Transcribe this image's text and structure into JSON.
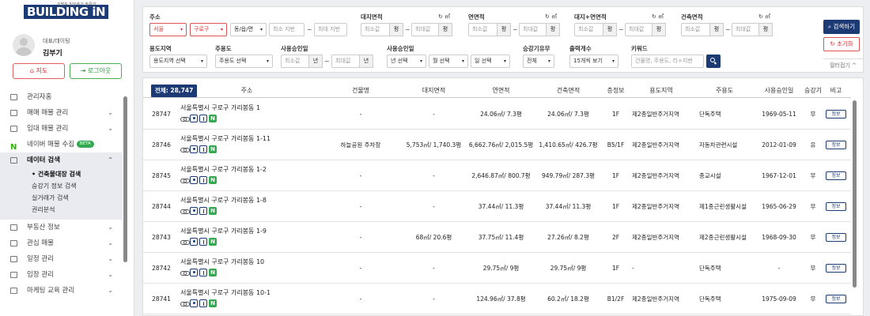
{
  "logo": {
    "text": "BUILDING iN",
    "tagline": "성명된 빌딩주거 솔루션"
  },
  "profile": {
    "role": "대표/데이팅",
    "name": "김부기"
  },
  "profile_buttons": {
    "map": "지도",
    "logout": "로그아웃"
  },
  "menu": [
    {
      "label": "관리자홈",
      "chev": ""
    },
    {
      "label": "매매 매물 관리",
      "chev": "⌄"
    },
    {
      "label": "임대 매물 관리",
      "chev": "⌄"
    },
    {
      "label": "네이버 매물 수집",
      "chev": "",
      "badge": "BETA"
    },
    {
      "label": "데이터 검색",
      "chev": "⌃"
    }
  ],
  "submenu": [
    "건축물대장 검색",
    "승강기 정보 검색",
    "실거래가 검색",
    "권리분석"
  ],
  "menu2": [
    {
      "label": "부동산 정보",
      "chev": "⌄"
    },
    {
      "label": "관심 매물",
      "chev": "⌄"
    },
    {
      "label": "일정 관리",
      "chev": "⌄"
    },
    {
      "label": "임장 관리",
      "chev": "⌄"
    },
    {
      "label": "마케팅 교육 관리",
      "chev": "⌄"
    }
  ],
  "filters": {
    "address_label": "주소",
    "sido": "서울",
    "gu": "구로구",
    "dong": "동/읍/면",
    "jibun_min": "최소 지번",
    "jibun_max": "최대 지번",
    "land_label": "대지면적",
    "floor_label": "연면적",
    "landfloor_label": "대지+연면적",
    "building_label": "건축면적",
    "min": "최소값",
    "max": "최대값",
    "unit_pyeong": "평",
    "unit_year": "년",
    "refresh": "↻ ㎡",
    "usezone_label": "용도지역",
    "usezone_value": "용도지역 선택",
    "mainuse_label": "주용도",
    "mainuse_value": "주용도 선택",
    "approval_label": "사용승인일",
    "approval_date_label": "사용승인일",
    "year_select": "년 선택",
    "month_select": "월 선택",
    "day_select": "일 선택",
    "elevator_label": "승강기유무",
    "elevator_value": "전체",
    "count_label": "출력개수",
    "count_value": "15개씩 보기",
    "keyword_label": "키워드",
    "keyword_placeholder": "건물명, 주용도, 리+지번",
    "search_button": "검색하기",
    "reset_button": "초기화",
    "fold_button": "필터접기 ^"
  },
  "table": {
    "total": "전체: 28,747",
    "headers": [
      "주소",
      "건물명",
      "대지면적",
      "연면적",
      "건축면적",
      "층정보",
      "용도지역",
      "주용도",
      "사용승인일",
      "승강기",
      "비고"
    ],
    "info_label": "정보",
    "rows": [
      {
        "no": "28747",
        "addr": "서울특별시 구로구 가리봉동 1",
        "name": "-",
        "land": "-",
        "floor": "24.06㎡/ 7.3평",
        "build": "24.06㎡/ 7.3평",
        "fl": "1F",
        "zone": "제2종일반주거지역",
        "use": "단독주택",
        "date": "1969-05-11",
        "elev": "무"
      },
      {
        "no": "28746",
        "addr": "서울특별시 구로구 가리봉동 1-11",
        "name": "하늘공원 주차장",
        "land": "5,753㎡/ 1,740.3평",
        "floor": "6,662.76㎡/ 2,015.5평",
        "build": "1,410.65㎡/ 426.7평",
        "fl": "B5/1F",
        "zone": "제2종일반주거지역",
        "use": "자동차관련시설",
        "date": "2012-01-09",
        "elev": "유"
      },
      {
        "no": "28745",
        "addr": "서울특별시 구로구 가리봉동 1-2",
        "name": "-",
        "land": "-",
        "floor": "2,646.87㎡/ 800.7평",
        "build": "949.79㎡/ 287.3평",
        "fl": "1F",
        "zone": "제2종일반주거지역",
        "use": "종교시설",
        "date": "1967-12-01",
        "elev": "무"
      },
      {
        "no": "28744",
        "addr": "서울특별시 구로구 가리봉동 1-8",
        "name": "-",
        "land": "-",
        "floor": "37.44㎡/ 11.3평",
        "build": "37.44㎡/ 11.3평",
        "fl": "1F",
        "zone": "제2종일반주거지역",
        "use": "제1종근린생활시설",
        "date": "1965-06-29",
        "elev": "무"
      },
      {
        "no": "28743",
        "addr": "서울특별시 구로구 가리봉동 1-9",
        "name": "-",
        "land": "68㎡/ 20.6평",
        "floor": "37.75㎡/ 11.4평",
        "build": "27.26㎡/ 8.2평",
        "fl": "2F",
        "zone": "제2종일반주거지역",
        "use": "제2종근린생활시설",
        "date": "1968-09-30",
        "elev": "무"
      },
      {
        "no": "28742",
        "addr": "서울특별시 구로구 가리봉동 10",
        "name": "-",
        "land": "-",
        "floor": "29.75㎡/ 9평",
        "build": "29.75㎡/ 9평",
        "fl": "1F",
        "zone": "-",
        "use": "단독주택",
        "date": "-",
        "elev": "무"
      },
      {
        "no": "28741",
        "addr": "서울특별시 구로구 가리봉동 10-1",
        "name": "-",
        "land": "-",
        "floor": "124.96㎡/ 37.8평",
        "build": "60.2㎡/ 18.2평",
        "fl": "B1/2F",
        "zone": "제2종일반주거지역",
        "use": "단독주택",
        "date": "1975-09-09",
        "elev": "무"
      }
    ]
  }
}
